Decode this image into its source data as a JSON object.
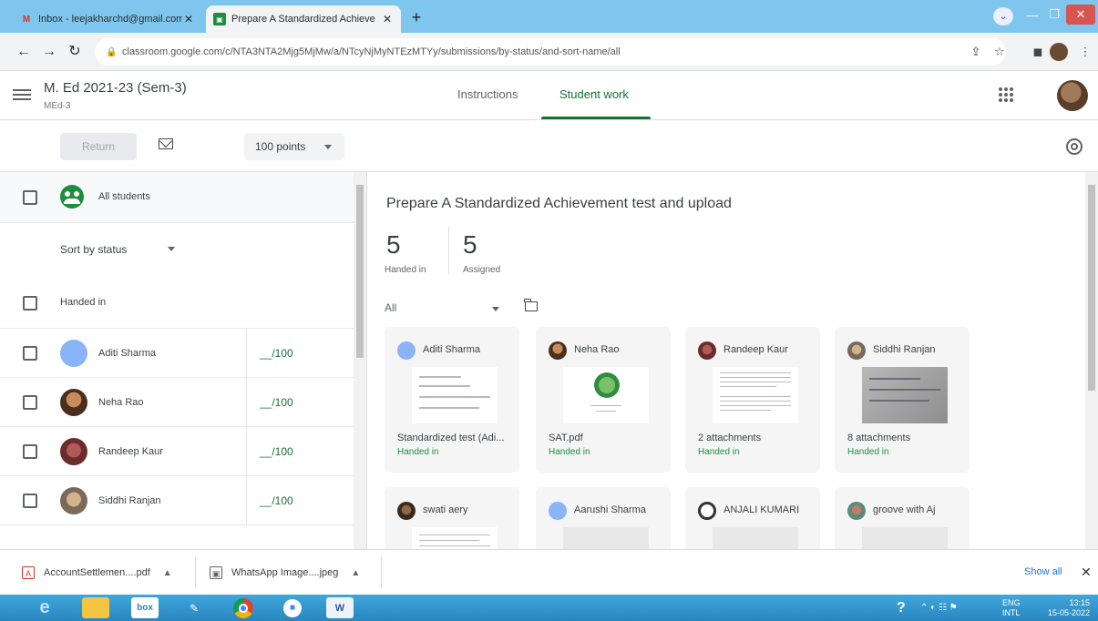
{
  "browser": {
    "tabs": [
      {
        "title": "Inbox - leejakharchd@gmail.com",
        "active": false
      },
      {
        "title": "Prepare A Standardized Achieve",
        "active": true
      }
    ],
    "new_tab_symbol": "+",
    "url": "classroom.google.com/c/NTA3NTA2Mjg5MjMw/a/NTcyNjMyNTEzMTYy/submissions/by-status/and-sort-name/all"
  },
  "header": {
    "course_title": "M. Ed 2021-23 (Sem-3)",
    "course_subtitle": "MEd-3",
    "tabs": [
      {
        "label": "Instructions",
        "active": false
      },
      {
        "label": "Student work",
        "active": true
      }
    ]
  },
  "toolbar": {
    "return_label": "Return",
    "points_label": "100 points"
  },
  "left_panel": {
    "all_students_label": "All students",
    "sort_label": "Sort by status",
    "section_label": "Handed in",
    "students": [
      {
        "name": "Aditi Sharma",
        "grade": "__/100"
      },
      {
        "name": "Neha Rao",
        "grade": "__/100"
      },
      {
        "name": "Randeep Kaur",
        "grade": "__/100"
      },
      {
        "name": "Siddhi Ranjan",
        "grade": "__/100"
      }
    ]
  },
  "right_panel": {
    "assignment_title": "Prepare A Standardized Achievement test and upload",
    "stats": [
      {
        "value": "5",
        "label": "Handed in"
      },
      {
        "value": "5",
        "label": "Assigned"
      }
    ],
    "filter_label": "All",
    "cards": [
      {
        "name": "Aditi Sharma",
        "file": "Standardized test (Adi...",
        "status": "Handed in"
      },
      {
        "name": "Neha Rao",
        "file": "SAT.pdf",
        "status": "Handed in"
      },
      {
        "name": "Randeep Kaur",
        "file": "2 attachments",
        "status": "Handed in"
      },
      {
        "name": "Siddhi Ranjan",
        "file": "8 attachments",
        "status": "Handed in"
      },
      {
        "name": "swati aery",
        "file": "",
        "status": ""
      },
      {
        "name": "Aarushi Sharma",
        "file": "",
        "status": ""
      },
      {
        "name": "ANJALI KUMARI",
        "file": "",
        "status": ""
      },
      {
        "name": "groove with Aj",
        "file": "",
        "status": ""
      }
    ]
  },
  "downloads": {
    "items": [
      {
        "name": "AccountSettlemen....pdf",
        "icon": "pdf-icon"
      },
      {
        "name": "WhatsApp Image....jpeg",
        "icon": "image-icon"
      }
    ],
    "show_all_label": "Show all"
  },
  "taskbar": {
    "language": "ENG",
    "locale": "INTL",
    "time": "13:15",
    "date": "15-05-2022"
  },
  "colors": {
    "accent_green": "#137333",
    "handed_in_green": "#1e8e3e",
    "tab_strip": "#7fc6ee",
    "taskbar": "#2a86bf"
  }
}
